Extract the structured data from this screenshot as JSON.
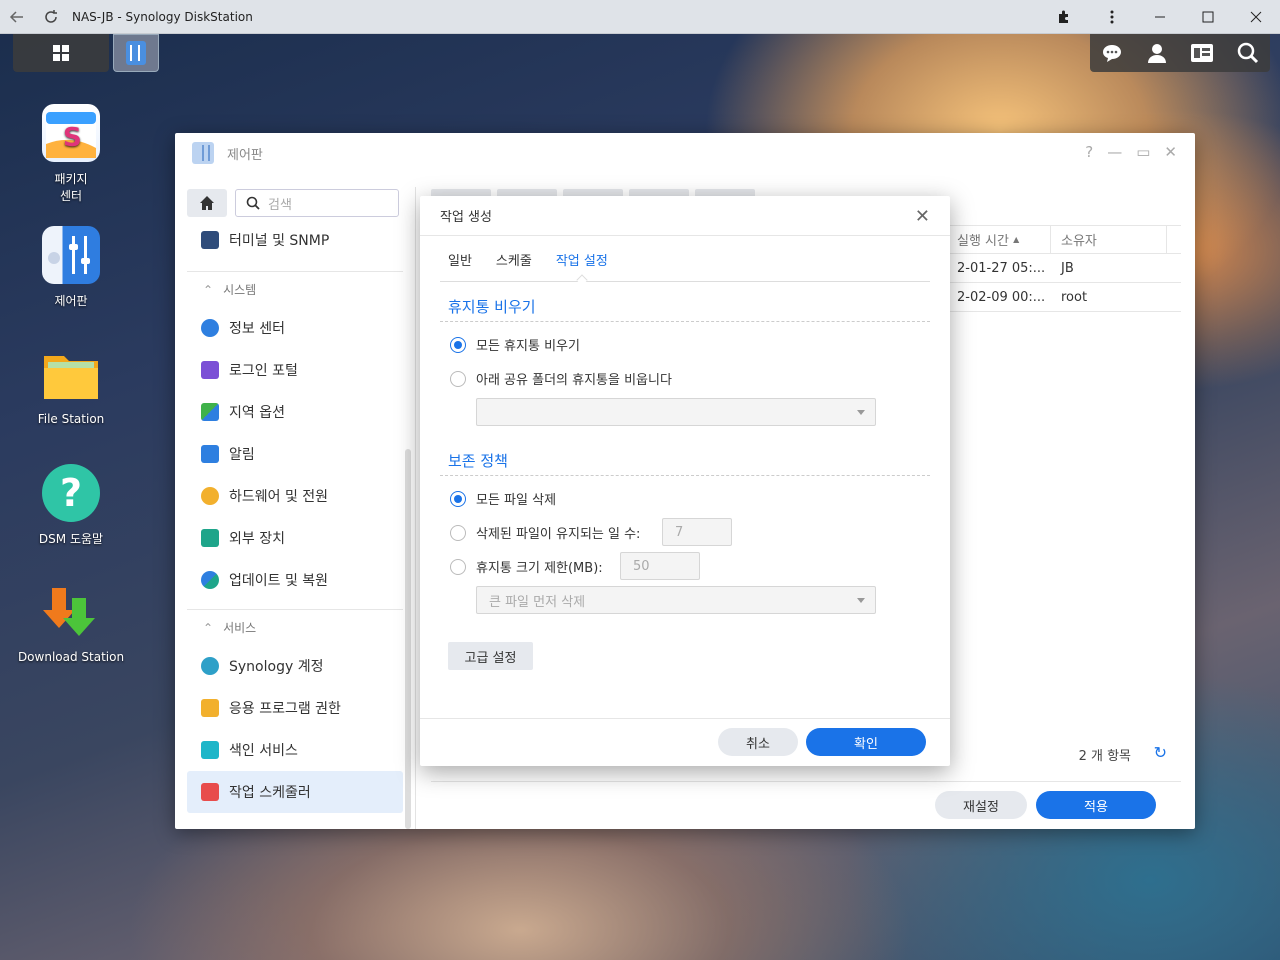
{
  "browser": {
    "title": "NAS-JB - Synology DiskStation"
  },
  "desktop": {
    "icons": [
      {
        "label_line1": "패키지",
        "label_line2": "센터"
      },
      {
        "label": "제어판"
      },
      {
        "label": "File Station"
      },
      {
        "label": "DSM 도움말"
      },
      {
        "label": "Download Station"
      }
    ]
  },
  "control_panel": {
    "title": "제어판",
    "search_placeholder": "검색",
    "nav": {
      "terminal": "터미널 및 SNMP",
      "section_system": "시스템",
      "info_center": "정보 센터",
      "login_portal": "로그인 포털",
      "regional": "지역 옵션",
      "notification": "알림",
      "hardware": "하드웨어 및 전원",
      "external": "외부 장치",
      "update": "업데이트 및 복원",
      "section_services": "서비스",
      "synology_account": "Synology 계정",
      "app_privileges": "응용 프로그램 권한",
      "indexing": "색인 서비스",
      "task_scheduler": "작업 스케줄러"
    },
    "table": {
      "col_time": "실행 시간",
      "col_owner": "소유자",
      "rows": [
        {
          "time": "2-01-27 05:...",
          "owner": "JB"
        },
        {
          "time": "2-02-09 00:...",
          "owner": "root"
        }
      ]
    },
    "item_count": "2 개 항목",
    "reset_label": "재설정",
    "apply_label": "적용"
  },
  "dialog": {
    "title": "작업 생성",
    "tabs": [
      "일반",
      "스케줄",
      "작업 설정"
    ],
    "section1": "휴지통 비우기",
    "opt_all_recycle": "모든 휴지통 비우기",
    "opt_shared_folders": "아래 공유 폴더의 휴지통을 비웁니다",
    "section2": "보존 정책",
    "opt_delete_all": "모든 파일 삭제",
    "opt_days": "삭제된 파일이 유지되는 일 수:",
    "days_value": "7",
    "opt_size": "휴지통 크기 제한(MB):",
    "size_value": "50",
    "size_policy": "큰 파일 먼저 삭제",
    "advanced_label": "고급 설정",
    "cancel_label": "취소",
    "ok_label": "확인"
  },
  "colors": {
    "accent": "#1a73e8"
  }
}
